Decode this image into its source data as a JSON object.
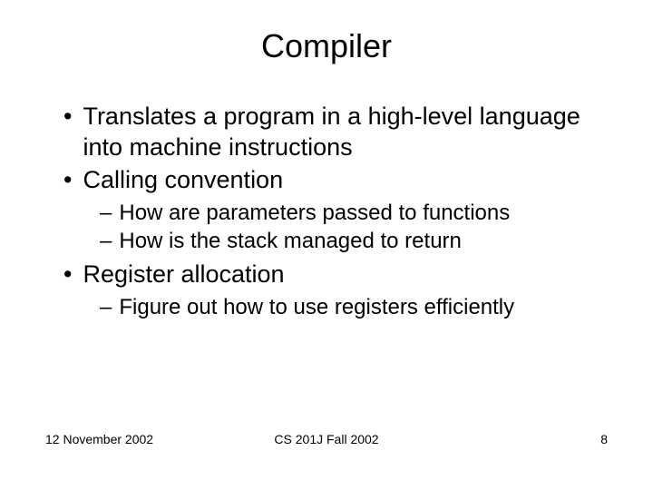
{
  "title": "Compiler",
  "bullets": [
    {
      "text": "Translates a program in a high-level language into machine instructions",
      "subs": []
    },
    {
      "text": "Calling convention",
      "subs": [
        "How are parameters passed to functions",
        "How is the stack managed to return"
      ]
    },
    {
      "text": "Register allocation",
      "subs": [
        "Figure out how to use registers efficiently"
      ]
    }
  ],
  "footer": {
    "date": "12 November 2002",
    "course": "CS 201J Fall 2002",
    "page": "8"
  }
}
